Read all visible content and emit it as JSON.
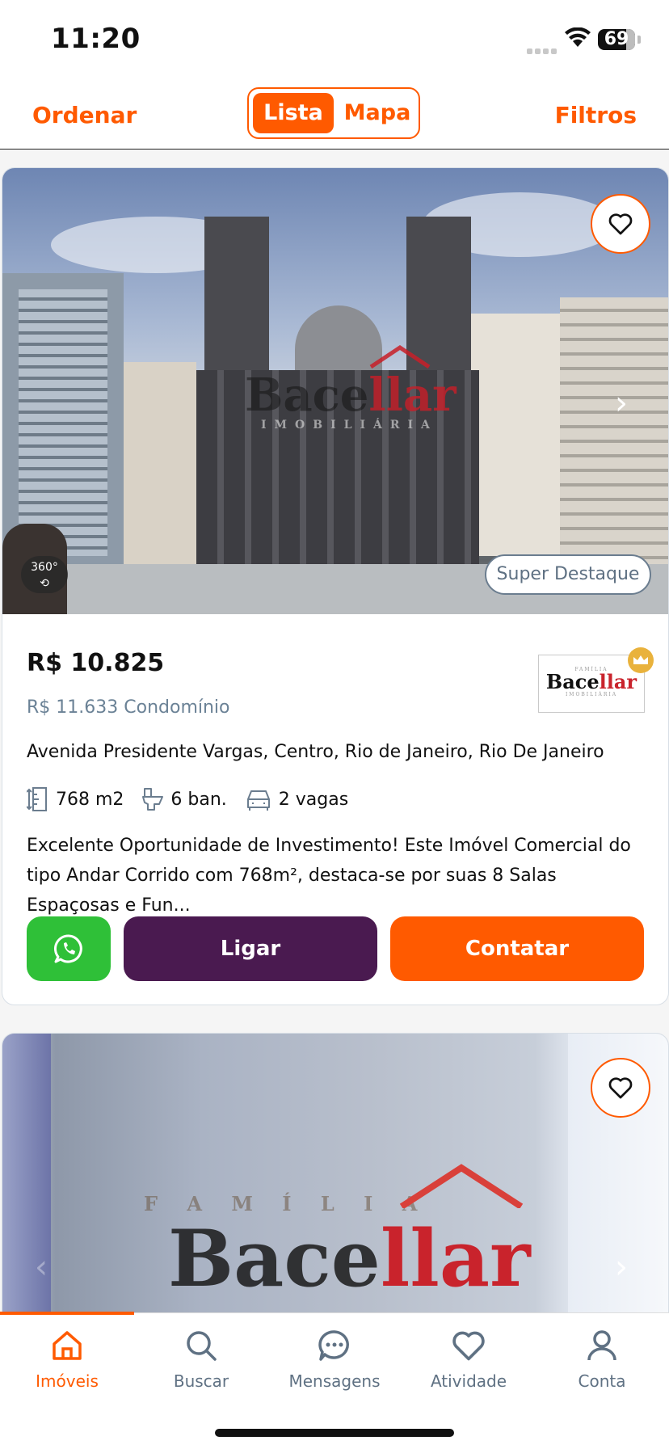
{
  "status": {
    "time": "11:20",
    "battery": "69"
  },
  "topbar": {
    "sort": "Ordenar",
    "tabs": [
      "Lista",
      "Mapa"
    ],
    "filters": "Filtros"
  },
  "listing1": {
    "watermark_name": "Bacellar",
    "watermark_name_left": "Bace",
    "watermark_name_right": "llar",
    "watermark_sub": "IMOBILIÁRIA",
    "badge_360": "360°",
    "highlight": "Super Destaque",
    "price": "R$ 10.825",
    "condo": "R$ 11.633 Condomínio",
    "agency": {
      "top": "FAMÍLIA",
      "name_left": "Bace",
      "name_right": "llar",
      "sub": "IMOBILIÁRIA"
    },
    "address": "Avenida Presidente Vargas, Centro, Rio de Janeiro, Rio De Janeiro",
    "features": {
      "area": "768 m2",
      "bath": "6  ban.",
      "parking": "2 vagas"
    },
    "description": "Excelente Oportunidade de Investimento! Este Imóvel Comercial do tipo Andar Corrido com 768m², destaca-se por suas 8 Salas Espaçosas e Fun...",
    "buttons": {
      "call": "Ligar",
      "contact": "Contatar"
    }
  },
  "listing2": {
    "watermark_top": "F A M Í L I A",
    "watermark_left": "Bace",
    "watermark_right": "llar"
  },
  "nav": {
    "items": [
      "Imóveis",
      "Buscar",
      "Mensagens",
      "Atividade",
      "Conta"
    ]
  },
  "colors": {
    "accent": "#ff5a00",
    "purple": "#4a1a50",
    "whatsapp": "#2fc038",
    "muted": "#5f7183"
  }
}
